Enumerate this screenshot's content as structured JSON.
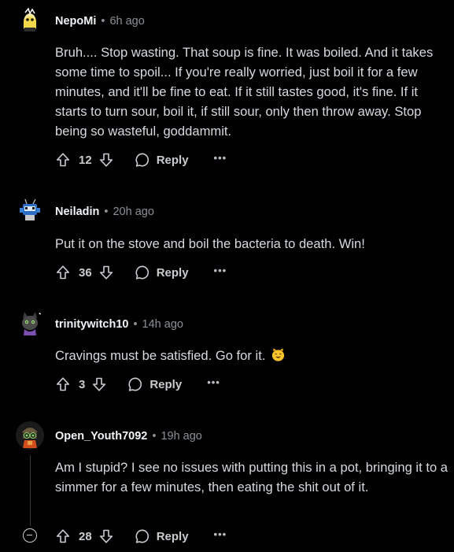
{
  "colors": {
    "background": "#000000",
    "text": "#d7dadc",
    "muted": "#8b9196",
    "username": "#f2f4f5"
  },
  "comments": [
    {
      "username": "NepoMi",
      "separator": "•",
      "time": "6h ago",
      "avatar_icon": "snoo-avatar-yellow-icon",
      "body": "Bruh.... Stop wasting. That soup is fine. It was boiled. And it takes some time to spoil... If you're really worried, just boil it for a few minutes, and it'll be fine to eat. If it still tastes good, it's fine. If it starts to turn sour, boil it, if still sour, only then throw away. Stop being so wasteful, goddammit.",
      "score": "12",
      "reply_label": "Reply",
      "more_label": "•••"
    },
    {
      "username": "Neiladin",
      "separator": "•",
      "time": "20h ago",
      "avatar_icon": "robot-avatar-icon",
      "body": "Put it on the stove and boil the bacteria to death. Win!",
      "score": "36",
      "reply_label": "Reply",
      "more_label": "•••"
    },
    {
      "username": "trinitywitch10",
      "separator": "•",
      "time": "14h ago",
      "avatar_icon": "cat-avatar-icon",
      "body": "Cravings must be satisfied. Go for it.",
      "emoji": "smiling-cat-emoji-icon",
      "score": "3",
      "reply_label": "Reply",
      "more_label": "•••"
    },
    {
      "username": "Open_Youth7092",
      "separator": "•",
      "time": "19h ago",
      "avatar_icon": "goggles-avatar-icon",
      "body": "Am I stupid? I see no issues with putting this in a pot, bringing it to a simmer for a few minutes, then eating the shit out of it.",
      "score": "28",
      "reply_label": "Reply",
      "more_label": "•••"
    }
  ]
}
